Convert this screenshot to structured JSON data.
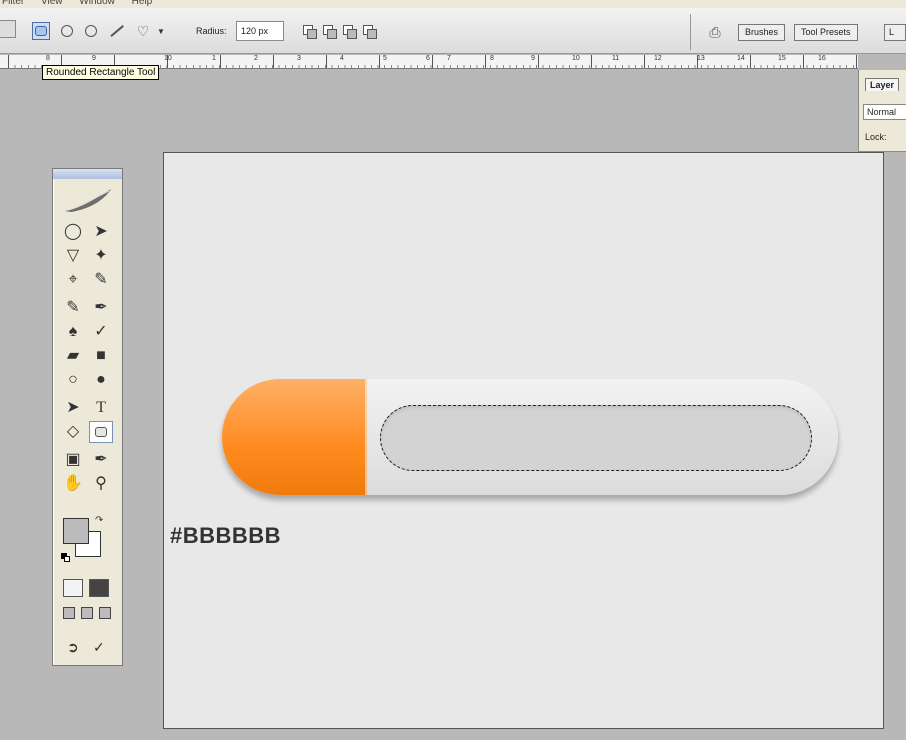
{
  "menubar": {
    "items": [
      "Filter",
      "View",
      "Window",
      "Help"
    ]
  },
  "options_bar": {
    "active_tool": "rounded-rectangle",
    "radius_label": "Radius:",
    "radius_value": "120 px",
    "palette_tabs": [
      "Brushes",
      "Tool Presets",
      "L"
    ]
  },
  "ruler": {
    "numbers": [
      "8",
      "9",
      "10",
      "1",
      "2",
      "3",
      "4",
      "5",
      "6",
      "7",
      "8",
      "9",
      "10",
      "11",
      "12",
      "13",
      "14",
      "15",
      "16"
    ]
  },
  "tooltip": {
    "text": "Rounded Rectangle Tool"
  },
  "layers_panel": {
    "tab": "Layer",
    "blend_mode": "Normal",
    "lock_label": "Lock:"
  },
  "toolbox": {
    "foreground_color": "#BBBBBB",
    "background_color": "#FFFFFF"
  },
  "canvas": {
    "background": "#E8E8E8",
    "progress_fraction": 0.235,
    "progress_color": "#FF8A1E",
    "label": "#BBBBBB"
  }
}
